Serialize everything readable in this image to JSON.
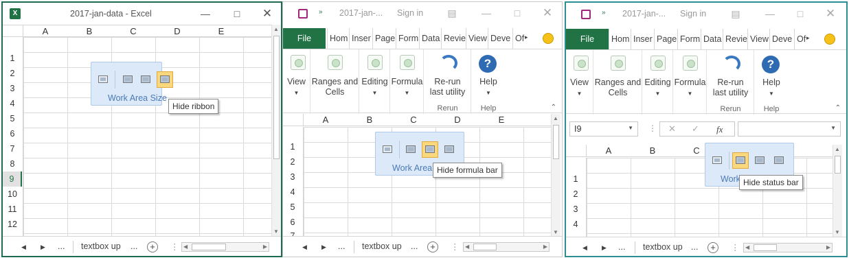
{
  "win1": {
    "title": "2017-jan-data - Excel",
    "app_icon": "excel-icon",
    "columns": [
      "A",
      "B",
      "C",
      "D",
      "E"
    ],
    "rows": [
      "1",
      "2",
      "3",
      "4",
      "5",
      "6",
      "7",
      "8",
      "9",
      "10",
      "11",
      "12"
    ],
    "selected_row": "9",
    "popup_label": "Work Area Size",
    "tooltip": "Hide ribbon",
    "sheet_tab": "textbox up",
    "ellipsis": "..."
  },
  "win2": {
    "title": "2017-jan-...",
    "sign_in": "Sign in",
    "tab_file": "File",
    "tabs": [
      "Hom",
      "Inser",
      "Page",
      "Form",
      "Data",
      "Revie",
      "View",
      "Deve",
      "Of"
    ],
    "ribbon": {
      "view": "View",
      "ranges_1": "Ranges and",
      "ranges_2": "Cells",
      "editing": "Editing",
      "formula": "Formula",
      "rerun_1": "Re-run",
      "rerun_2": "last utility",
      "rerun_group": "Rerun",
      "help": "Help",
      "help_group": "Help"
    },
    "columns": [
      "A",
      "B",
      "C",
      "D",
      "E"
    ],
    "rows": [
      "1",
      "2",
      "3",
      "4",
      "5",
      "6",
      "7"
    ],
    "popup_label": "Work Area",
    "tooltip": "Hide formula bar",
    "sheet_tab": "textbox up",
    "ellipsis": "..."
  },
  "win3": {
    "title": "2017-jan-...",
    "sign_in": "Sign in",
    "tab_file": "File",
    "tabs": [
      "Hom",
      "Inser",
      "Page",
      "Form",
      "Data",
      "Revie",
      "View",
      "Deve",
      "Of"
    ],
    "ribbon": {
      "view": "View",
      "ranges_1": "Ranges and",
      "ranges_2": "Cells",
      "editing": "Editing",
      "formula": "Formula",
      "rerun_1": "Re-run",
      "rerun_2": "last utility",
      "rerun_group": "Rerun",
      "help": "Help",
      "help_group": "Help"
    },
    "name_box": "I9",
    "fx": "fx",
    "columns": [
      "A",
      "B",
      "C"
    ],
    "rows": [
      "1",
      "2",
      "3",
      "4"
    ],
    "popup_label": "Work",
    "tooltip": "Hide status bar",
    "sheet_tab": "textbox up",
    "ellipsis": "..."
  },
  "colors": {
    "excel_green": "#217346",
    "popup_bg": "#dce9f8",
    "selected": "#fbd77d",
    "label_blue": "#4a7ab8"
  }
}
